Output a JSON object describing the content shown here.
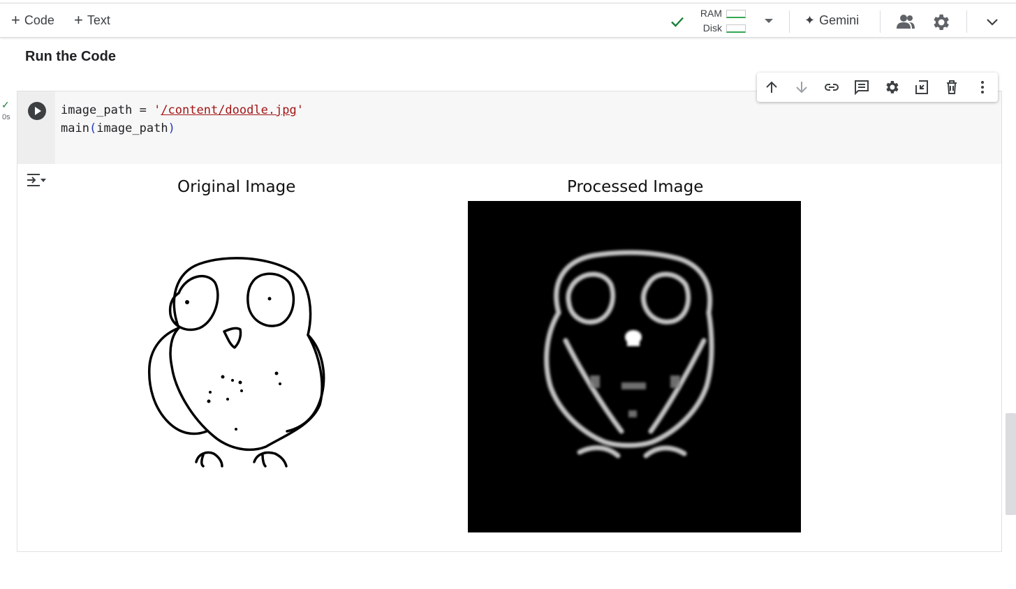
{
  "toolbar": {
    "add_code_label": "Code",
    "add_text_label": "Text",
    "ram_label": "RAM",
    "disk_label": "Disk",
    "gemini_label": "Gemini",
    "connected_status_color": "#188038"
  },
  "section": {
    "title": "Run the Code"
  },
  "cell": {
    "exec_status": "✓",
    "exec_time": "0s",
    "code_line1_var": "image_path = ",
    "code_line1_quote_open": "'",
    "code_line1_path": "/content/doodle.jpg",
    "code_line1_quote_close": "'",
    "code_line2_func": "main",
    "code_line2_paren_open": "(",
    "code_line2_arg": "image_path",
    "code_line2_paren_close": ")",
    "toolbar_icons": [
      "arrow-up-icon",
      "arrow-down-icon",
      "link-icon",
      "comment-icon",
      "gear-icon",
      "mirror-cell-icon",
      "trash-icon",
      "more-vert-icon"
    ]
  },
  "output": {
    "original_title": "Original Image",
    "processed_title": "Processed Image"
  },
  "icons": {
    "add": "+",
    "spark": "✦"
  }
}
